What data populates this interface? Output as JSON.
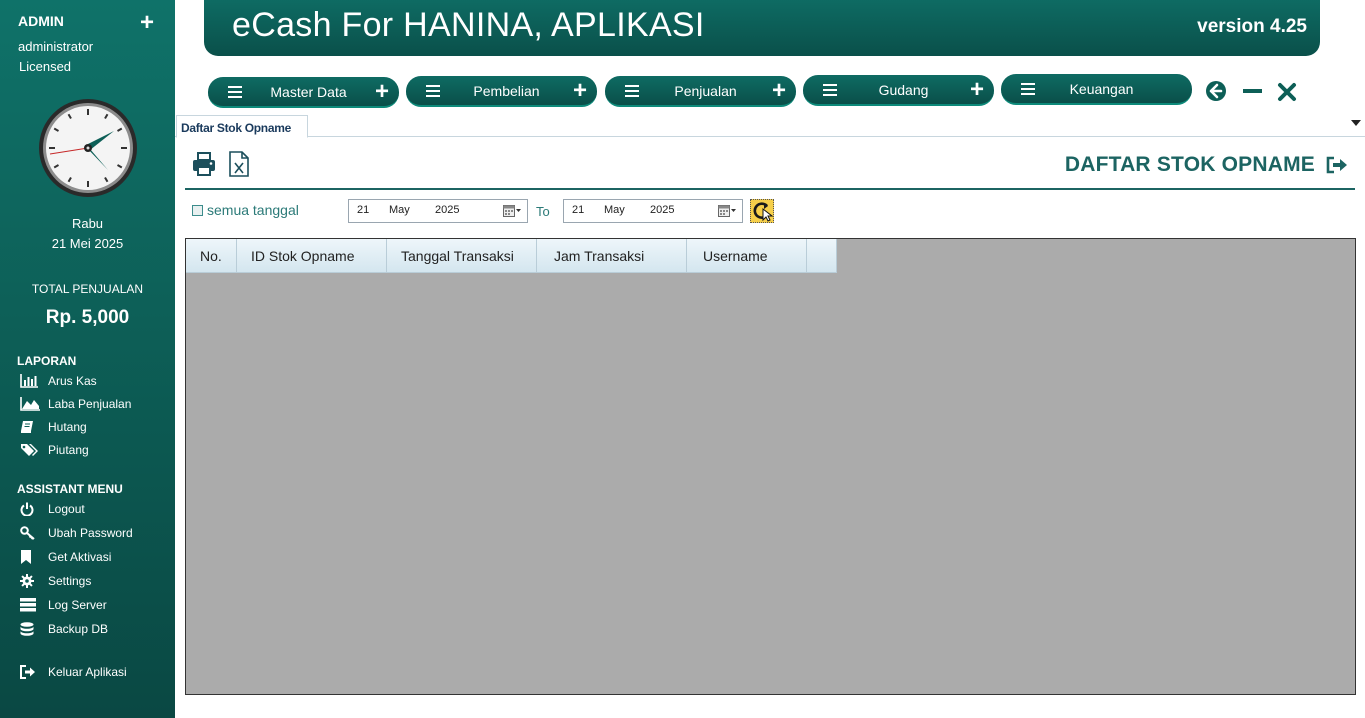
{
  "sidebar": {
    "admin_label": "ADMIN",
    "plus": "+",
    "username": "administrator",
    "license": "Licensed",
    "day": "Rabu",
    "date": "21 Mei 2025",
    "total_label": "TOTAL PENJUALAN",
    "total_value": "Rp. 5,000",
    "laporan_title": "LAPORAN",
    "laporan": [
      {
        "label": "Arus Kas",
        "icon": "bar-chart-icon"
      },
      {
        "label": "Laba Penjualan",
        "icon": "area-chart-icon"
      },
      {
        "label": "Hutang",
        "icon": "book-icon"
      },
      {
        "label": "Piutang",
        "icon": "tags-icon"
      }
    ],
    "assistant_title": "ASSISTANT MENU",
    "assistant": [
      {
        "label": "Logout",
        "icon": "power-icon"
      },
      {
        "label": "Ubah Password",
        "icon": "key-icon"
      },
      {
        "label": "Get Aktivasi",
        "icon": "bookmark-icon"
      },
      {
        "label": "Settings",
        "icon": "gear-icon"
      },
      {
        "label": "Log Server",
        "icon": "server-icon"
      },
      {
        "label": "Backup DB",
        "icon": "database-icon"
      }
    ],
    "exit_label": "Keluar Aplikasi"
  },
  "header": {
    "title": "eCash For HANINA, APLIKASI",
    "version": "version 4.25"
  },
  "menu": [
    {
      "label": "Master Data",
      "plus": "+"
    },
    {
      "label": "Pembelian",
      "plus": "+"
    },
    {
      "label": "Penjualan",
      "plus": "+"
    },
    {
      "label": "Gudang",
      "plus": "+"
    },
    {
      "label": "Keuangan",
      "plus": ""
    }
  ],
  "tab": {
    "label": "Daftar Stok Opname"
  },
  "page": {
    "title": "DAFTAR STOK OPNAME"
  },
  "filter": {
    "checkbox_label": "semua tanggal",
    "checked": false,
    "from": {
      "day": "21",
      "month": "May",
      "year": "2025"
    },
    "to_label": "To",
    "to": {
      "day": "21",
      "month": "May",
      "year": "2025"
    }
  },
  "grid": {
    "columns": [
      "No.",
      "ID Stok Opname",
      "Tanggal Transaksi",
      "Jam Transaksi",
      "Username",
      ""
    ],
    "rows": []
  },
  "colors": {
    "sidebar": "#0d5f57",
    "accent": "#1c6462",
    "grid_bg": "#ababab",
    "refresh_button": "#f6cf4a"
  }
}
